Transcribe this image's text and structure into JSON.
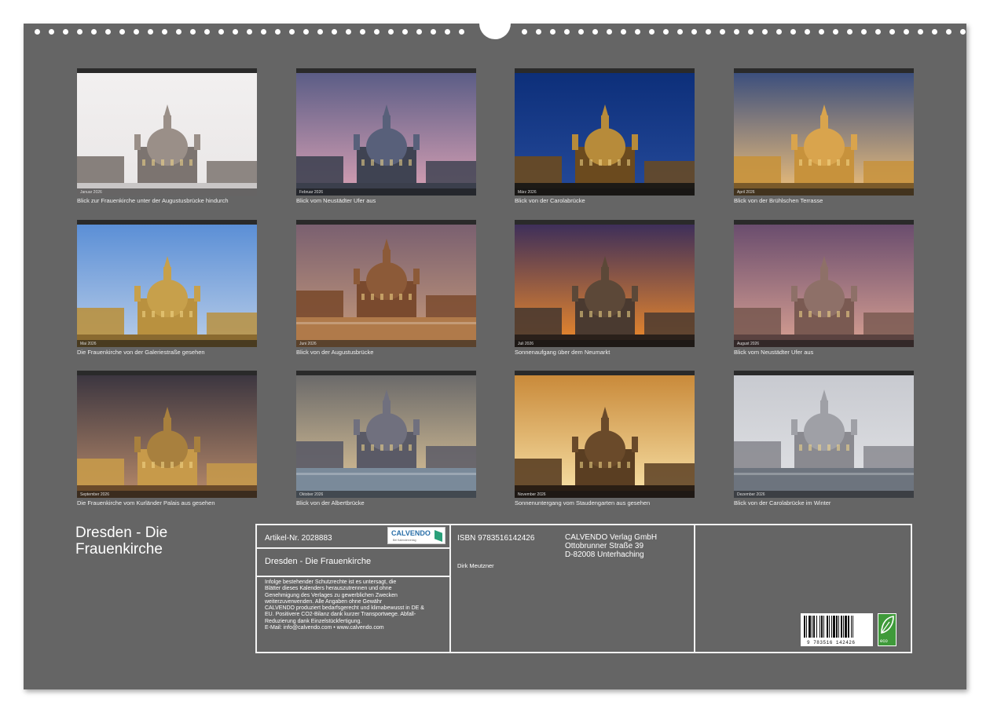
{
  "photos": [
    {
      "caption": "Blick zur Frauenkirche unter der Augustusbrücke hindurch",
      "month": "Januar 2026",
      "theme": "snow"
    },
    {
      "caption": "Blick vom Neustädter Ufer aus",
      "month": "Februar 2026",
      "theme": "pink-dusk"
    },
    {
      "caption": "Blick von der Carolabrücke",
      "month": "März 2026",
      "theme": "night-blue"
    },
    {
      "caption": "Blick von der Brühlschen Terrasse",
      "month": "April 2026",
      "theme": "sunset-gold"
    },
    {
      "caption": "Die Frauenkirche von der Galeriestraße gesehen",
      "month": "Mai 2026",
      "theme": "blue-day"
    },
    {
      "caption": "Blick von der Augustusbrücke",
      "month": "Juni 2026",
      "theme": "river-dusk"
    },
    {
      "caption": "Sonnenaufgang über dem Neumarkt",
      "month": "Juli 2026",
      "theme": "fire-sky"
    },
    {
      "caption": "Blick vom Neustädter Ufer aus",
      "month": "August 2026",
      "theme": "lilac-dusk"
    },
    {
      "caption": "Die Frauenkirche vom Kurländer Palais aus gesehen",
      "month": "September 2026",
      "theme": "storm-warm"
    },
    {
      "caption": "Blick von der Albertbrücke",
      "month": "Oktober 2026",
      "theme": "green-evening"
    },
    {
      "caption": "Sonnenuntergang vom Staudengarten aus gesehen",
      "month": "November 2026",
      "theme": "sunburst"
    },
    {
      "caption": "Blick von der Carolabrücke im Winter",
      "month": "Dezember 2026",
      "theme": "winter-grey"
    }
  ],
  "title_line1": "Dresden - Die",
  "title_line2": "Frauenkirche",
  "info": {
    "article_label": "Artikel-Nr. 2028883",
    "calvendo_logo": "CALVENDO",
    "calvendo_logo_sub": "Bei Kalenderverlag",
    "subtitle": "Dresden - Die Frauenkirche",
    "isbn": "ISBN 9783516142426",
    "author": "Dirk Meutzner",
    "publisher": [
      "CALVENDO Verlag GmbH",
      "Ottobrunner Straße 39",
      "D-82008 Unterhaching"
    ],
    "legal": [
      "Infolge bestehender Schutzrechte ist es untersagt, die",
      "Blätter dieses Kalenders herauszutrennen und ohne",
      "Genehmigung des Verlages zu gewerblichen Zwecken",
      "weiterzuverwenden. Alle Angaben ohne Gewähr",
      "CALVENDO produziert bedarfsgerecht und klimabewusst in DE &",
      "EU. Positivere CO2-Bilanz dank kurzer Transportwege. Abfall-",
      "Reduzierung dank Einzelstückfertigung.",
      "E-Mail: info@calvendo.com • www.calvendo.com"
    ],
    "barcode_digits": "9 783516 142426",
    "eco_label": "eco"
  },
  "colors": {
    "background": "#656565",
    "frame": "#f2f2f2",
    "text": "#ffffff"
  }
}
